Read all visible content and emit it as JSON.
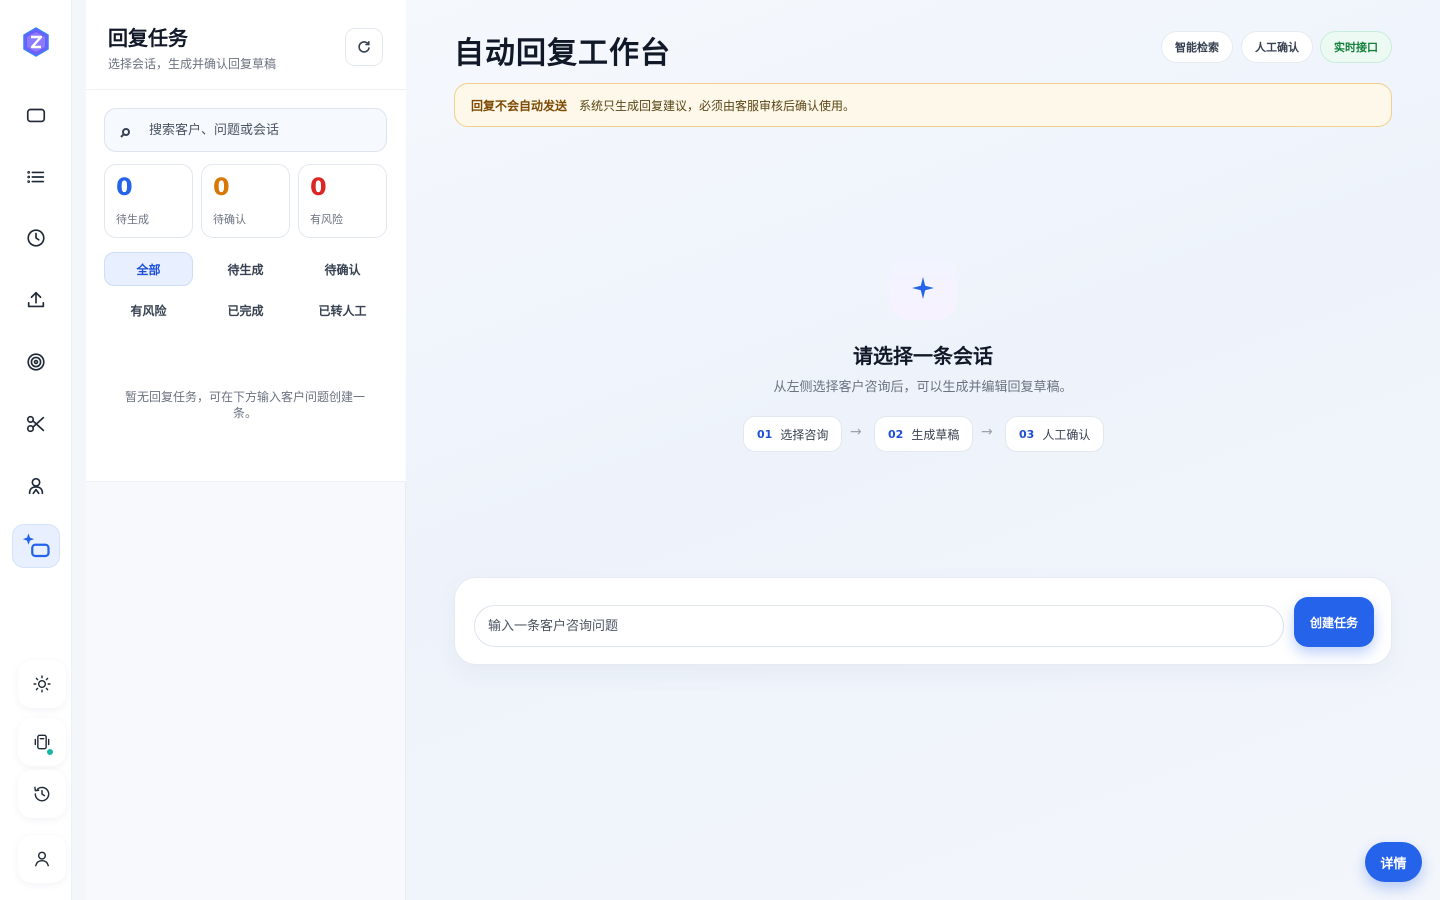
{
  "rail": {
    "icons": [
      "app-logo-icon",
      "window-icon",
      "list-icon",
      "clock-icon",
      "upload-icon",
      "target-icon",
      "scissors-icon",
      "agent-icon",
      "auto-reply-icon"
    ],
    "bottom_icons": [
      "sun-icon",
      "device-icon",
      "history-icon",
      "user-icon"
    ],
    "active_item": "auto-reply-icon",
    "status_color": "#14b8a6"
  },
  "panel": {
    "title": "回复任务",
    "subtitle": "选择会话，生成并确认回复草稿",
    "search_placeholder": "搜索客户、问题或会话",
    "stats": [
      {
        "value": "0",
        "label": "待生成",
        "color": "#2563eb"
      },
      {
        "value": "0",
        "label": "待确认",
        "color": "#d97706"
      },
      {
        "value": "0",
        "label": "有风险",
        "color": "#dc2626"
      }
    ],
    "filters": [
      "全部",
      "待生成",
      "待确认",
      "有风险",
      "已完成",
      "已转人工"
    ],
    "active_filter": "全部",
    "empty_message": "暂无回复任务，可在下方输入客户问题创建一条。"
  },
  "main": {
    "title": "自动回复工作台",
    "chips": [
      "智能检索",
      "人工确认",
      "实时接口"
    ],
    "notice_strong": "回复不会自动发送",
    "notice_text": "系统只生成回复建议，必须由客服审核后确认使用。",
    "empty_title": "请选择一条会话",
    "empty_subtitle": "从左侧选择客户咨询后，可以生成并编辑回复草稿。",
    "steps": [
      {
        "no": "01",
        "label": "选择咨询"
      },
      {
        "no": "02",
        "label": "生成草稿"
      },
      {
        "no": "03",
        "label": "人工确认"
      }
    ],
    "arrow": "→",
    "composer_placeholder": "输入一条客户咨询问题",
    "create_button": "创建任务",
    "accent_color": "#2563eb"
  },
  "details_button": "详情"
}
